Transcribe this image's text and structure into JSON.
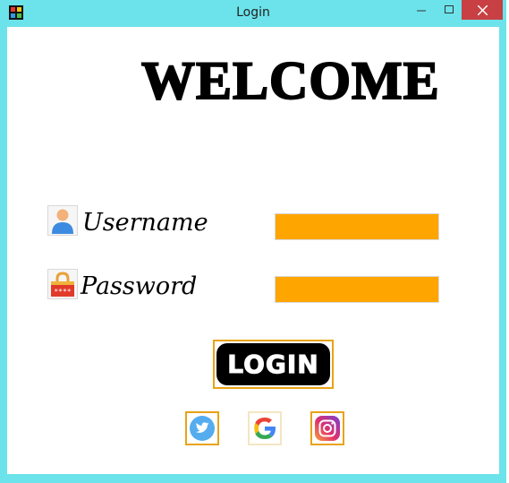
{
  "window": {
    "title": "Login"
  },
  "controls": {
    "minimize": "–",
    "maximize": "□",
    "close": "✕"
  },
  "main": {
    "heading": "WELCOME",
    "username": {
      "label": "Username",
      "value": ""
    },
    "password": {
      "label": "Password",
      "value": ""
    },
    "login_label": "LOGIN"
  },
  "social": [
    {
      "icon": "twitter-icon"
    },
    {
      "icon": "google-icon"
    },
    {
      "icon": "instagram-icon"
    }
  ],
  "colors": {
    "titlebar": "#6ce3ea",
    "field": "#ffa500",
    "button_border": "#e8a317",
    "close_button": "#c84043"
  }
}
